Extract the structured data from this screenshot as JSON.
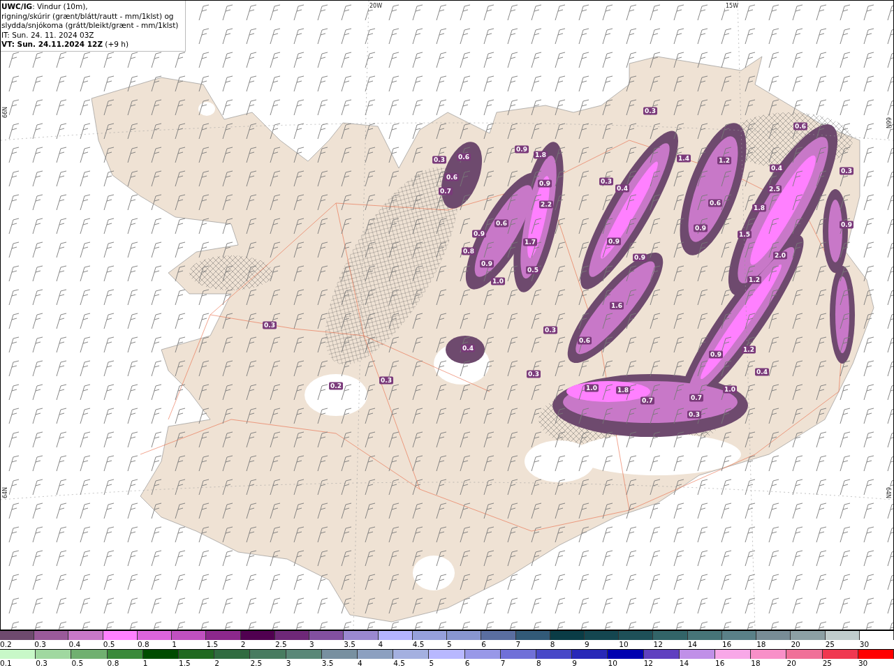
{
  "header": {
    "lines": [
      "**UWC/IG**: Vindur (10m),",
      "rigning/skúrir (grænt/blátt/rautt - mm/1klst) og",
      "slydda/snjókoma (grátt/bleikt/grænt - mm/1klst)",
      "IT: Sun. 24. 11. 2024 03Z",
      "**VT: Sun. 24.11.2024 12Z** (+9 h)"
    ]
  },
  "map": {
    "grid_labels": [
      "20W",
      "15W",
      "66N",
      "64N",
      "66N",
      "64N"
    ],
    "value_labels": [
      "0.3",
      "0.6",
      "0.9",
      "1.8",
      "0.3",
      "0.6",
      "1.4",
      "1.2",
      "0.4",
      "0.3",
      "0.6",
      "0.7",
      "0.9",
      "0.3",
      "0.4",
      "2.5",
      "2.2",
      "1.8",
      "0.6",
      "0.9",
      "1.7",
      "0.9",
      "0.9",
      "1.5",
      "0.9",
      "0.8",
      "0.6",
      "0.9",
      "0.5",
      "0.9",
      "2.0",
      "1.0",
      "1.2",
      "1.6",
      "0.3",
      "0.3",
      "0.6",
      "0.4",
      "0.9",
      "1.2",
      "0.4",
      "0.3",
      "0.2",
      "0.3",
      "1.0",
      "1.8",
      "0.7",
      "0.7",
      "1.0",
      "0.3"
    ]
  },
  "legends": [
    {
      "items": [
        {
          "label": "0.2",
          "color": "#6e4a6e"
        },
        {
          "label": "0.3",
          "color": "#9a5a9a"
        },
        {
          "label": "0.4",
          "color": "#c878c8"
        },
        {
          "label": "0.5",
          "color": "#ff80ff"
        },
        {
          "label": "0.8",
          "color": "#dc64dc"
        },
        {
          "label": "1",
          "color": "#c050c0"
        },
        {
          "label": "1.5",
          "color": "#8c288c"
        },
        {
          "label": "2",
          "color": "#500050"
        },
        {
          "label": "2.5",
          "color": "#6e2878"
        },
        {
          "label": "3",
          "color": "#8250a0"
        },
        {
          "label": "3.5",
          "color": "#9a88d0"
        },
        {
          "label": "4",
          "color": "#b4b4ff"
        },
        {
          "label": "4.5",
          "color": "#96a0dc"
        },
        {
          "label": "5",
          "color": "#8896d0"
        },
        {
          "label": "6",
          "color": "#5a6ea0"
        },
        {
          "label": "7",
          "color": "#325a78"
        },
        {
          "label": "8",
          "color": "#0a3c46"
        },
        {
          "label": "9",
          "color": "#144650"
        },
        {
          "label": "10",
          "color": "#1e5058"
        },
        {
          "label": "12",
          "color": "#326468"
        },
        {
          "label": "14",
          "color": "#467478"
        },
        {
          "label": "16",
          "color": "#5a8088"
        },
        {
          "label": "18",
          "color": "#788c96"
        },
        {
          "label": "20",
          "color": "#8ca0a4"
        },
        {
          "label": "25",
          "color": "#c0cccc"
        },
        {
          "label": "30",
          "color": "#ffffff"
        }
      ]
    },
    {
      "items": [
        {
          "label": "0.1",
          "color": "#c8f8c8"
        },
        {
          "label": "0.3",
          "color": "#a0d8a0"
        },
        {
          "label": "0.5",
          "color": "#70b070"
        },
        {
          "label": "0.8",
          "color": "#3a8a3a"
        },
        {
          "label": "1",
          "color": "#004c00"
        },
        {
          "label": "1.5",
          "color": "#206a20"
        },
        {
          "label": "2",
          "color": "#306c40"
        },
        {
          "label": "2.5",
          "color": "#487c60"
        },
        {
          "label": "3",
          "color": "#5a8878"
        },
        {
          "label": "3.5",
          "color": "#7890a0"
        },
        {
          "label": "4",
          "color": "#8ca0c0"
        },
        {
          "label": "4.5",
          "color": "#a4b0e0"
        },
        {
          "label": "5",
          "color": "#b8b8ff"
        },
        {
          "label": "6",
          "color": "#9898e8"
        },
        {
          "label": "7",
          "color": "#7070d8"
        },
        {
          "label": "8",
          "color": "#4848c8"
        },
        {
          "label": "9",
          "color": "#2828b8"
        },
        {
          "label": "10",
          "color": "#0000b0"
        },
        {
          "label": "12",
          "color": "#6040c0"
        },
        {
          "label": "14",
          "color": "#c090e8"
        },
        {
          "label": "16",
          "color": "#f8a8e8"
        },
        {
          "label": "18",
          "color": "#f890c8"
        },
        {
          "label": "20",
          "color": "#f07098"
        },
        {
          "label": "25",
          "color": "#f03850"
        },
        {
          "label": "30",
          "color": "#ff0000"
        }
      ]
    }
  ]
}
